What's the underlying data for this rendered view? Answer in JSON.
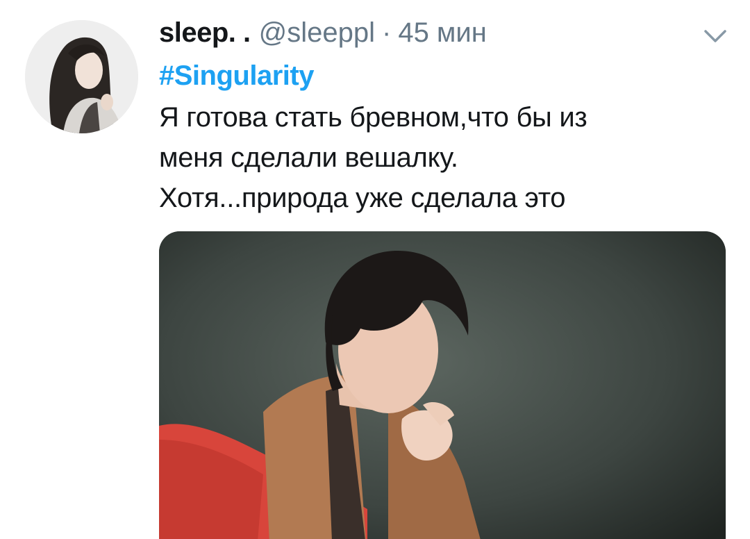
{
  "tweet": {
    "avatar_icon": "user-avatar-image",
    "display_name": "sleep. .",
    "handle": "@sleeppl",
    "separator": "·",
    "time": "45 мин",
    "menu_icon": "chevron-down-icon",
    "hashtag": "#Singularity",
    "text_lines": [
      "Я готова стать бревном,что бы из",
      "меня сделали вешалку.",
      "Хотя...природа уже сделала это"
    ],
    "media_icon": "photo-media"
  },
  "colors": {
    "text_primary": "#14171a",
    "text_secondary": "#657786",
    "link": "#1da1f2",
    "background": "#ffffff",
    "chevron": "#8899a6"
  }
}
